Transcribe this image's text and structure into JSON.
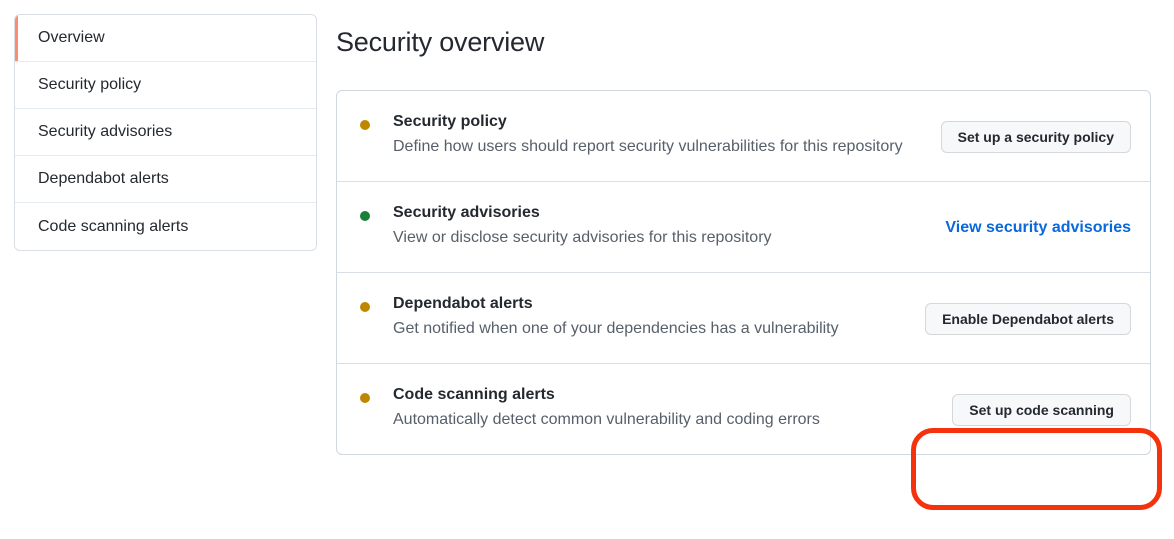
{
  "sidebar": {
    "items": [
      {
        "label": "Overview",
        "active": true
      },
      {
        "label": "Security policy",
        "active": false
      },
      {
        "label": "Security advisories",
        "active": false
      },
      {
        "label": "Dependabot alerts",
        "active": false
      },
      {
        "label": "Code scanning alerts",
        "active": false
      }
    ]
  },
  "main": {
    "page_title": "Security overview",
    "rows": [
      {
        "title": "Security policy",
        "description": "Define how users should report security vulnerabilities for this repository",
        "status_color": "#bf8700",
        "status_name": "warning",
        "action_type": "button",
        "action_label": "Set up a security policy"
      },
      {
        "title": "Security advisories",
        "description": "View or disclose security advisories for this repository",
        "status_color": "#1a7f37",
        "status_name": "enabled",
        "action_type": "link",
        "action_label": "View security advisories"
      },
      {
        "title": "Dependabot alerts",
        "description": "Get notified when one of your dependencies has a vulnerability",
        "status_color": "#bf8700",
        "status_name": "warning",
        "action_type": "button",
        "action_label": "Enable Dependabot alerts"
      },
      {
        "title": "Code scanning alerts",
        "description": "Automatically detect common vulnerability and coding errors",
        "status_color": "#bf8700",
        "status_name": "warning",
        "action_type": "button",
        "action_label": "Set up code scanning"
      }
    ]
  },
  "annotation": {
    "color": "#f4320c",
    "target": "Set up code scanning"
  }
}
